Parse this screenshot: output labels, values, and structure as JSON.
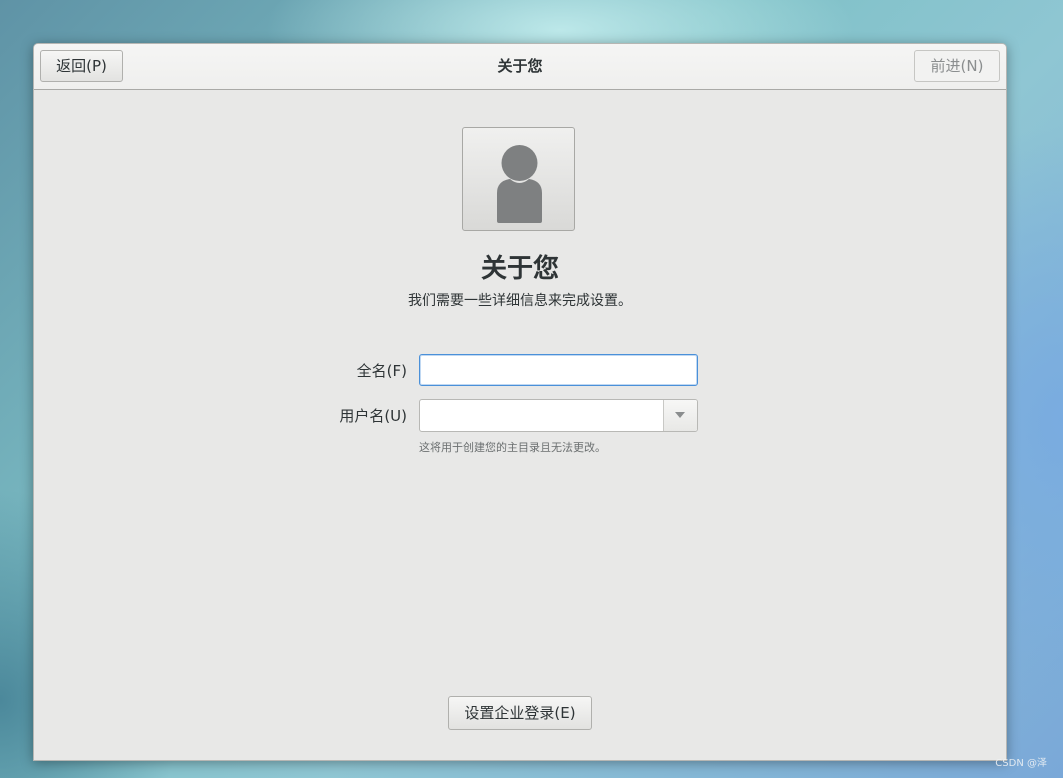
{
  "header": {
    "back_label": "返回(P)",
    "title": "关于您",
    "forward_label": "前进(N)"
  },
  "main": {
    "avatar_icon": "user-avatar-icon",
    "title": "关于您",
    "subtitle": "我们需要一些详细信息来完成设置。",
    "fullname": {
      "label": "全名(F)",
      "value": ""
    },
    "username": {
      "label": "用户名(U)",
      "value": "",
      "hint": "这将用于创建您的主目录且无法更改。"
    },
    "enterprise_label": "设置企业登录(E)"
  },
  "watermark": "CSDN @泽",
  "colors": {
    "focus": "#4a90d9",
    "window_bg": "#e8e8e7",
    "text": "#2e3436"
  }
}
